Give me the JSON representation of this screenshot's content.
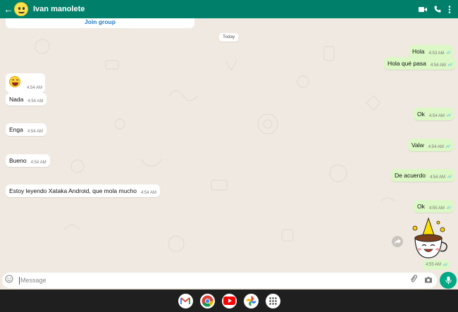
{
  "header": {
    "back_icon": "arrow-back-icon",
    "contact_name": "Ivan manolete",
    "icons": [
      "video-call-icon",
      "voice-call-icon",
      "more-vert-icon"
    ]
  },
  "banner": {
    "join_group": "Join group"
  },
  "date_divider": "Today",
  "messages": [
    {
      "dir": "out",
      "text": "Hola",
      "time": "4:53 AM",
      "read": true
    },
    {
      "dir": "out",
      "text": "Hola qué pasa",
      "time": "4:54 AM",
      "read": true
    },
    {
      "dir": "in",
      "text": "😆",
      "time": "4:54 AM"
    },
    {
      "dir": "in",
      "text": "Nada",
      "time": "4:54 AM"
    },
    {
      "dir": "out",
      "text": "Ok",
      "time": "4:54 AM",
      "read": true
    },
    {
      "dir": "in",
      "text": "Enga",
      "time": "4:54 AM"
    },
    {
      "dir": "out",
      "text": "Valw",
      "time": "4:54 AM",
      "read": true
    },
    {
      "dir": "in",
      "text": "Bueno",
      "time": "4:54 AM"
    },
    {
      "dir": "out",
      "text": "De acuerdo",
      "time": "4:54 AM",
      "read": true
    },
    {
      "dir": "in",
      "text": "Estoy leyendo Xataka Android, que mola mucho",
      "time": "4:54 AM"
    },
    {
      "dir": "out",
      "text": "Ok",
      "time": "4:55 AM",
      "read": true
    },
    {
      "dir": "out",
      "text": "",
      "sticker": "coffee-cup-party-sticker",
      "time": "4:55 AM",
      "read": true
    }
  ],
  "composer": {
    "placeholder": "Message",
    "icons": [
      "emoji-icon",
      "attach-icon",
      "camera-icon",
      "mic-icon"
    ]
  },
  "taskbar": {
    "apps": [
      "gmail-icon",
      "chrome-icon",
      "youtube-icon",
      "photos-icon",
      "app-drawer-icon"
    ]
  },
  "colors": {
    "header": "#00806a",
    "outgoing": "#dcf8c6",
    "incoming": "#ffffff",
    "accent": "#00a884",
    "read_ticks": "#4fb6ec",
    "link": "#1f7cc7"
  }
}
